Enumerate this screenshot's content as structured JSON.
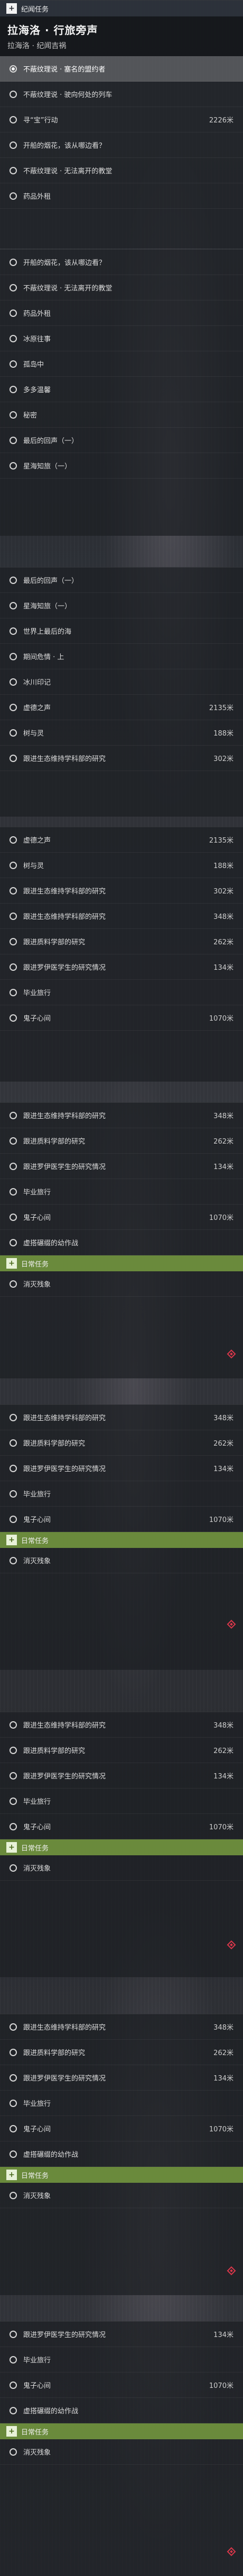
{
  "top": {
    "panel_label": "纪闻任务",
    "quest_title": "拉海洛 · 行旅旁声",
    "quest_subtitle": "拉海洛 · 纪闻吉祸"
  },
  "list1": [
    {
      "label": "不蔽纹理说 · 塞名的盟约者",
      "dist": "",
      "active": true
    },
    {
      "label": "不蔽纹理说 · 驶向何处的列车",
      "dist": ""
    },
    {
      "label": "寻“宝”行动",
      "dist": "2226米"
    },
    {
      "label": "开船的烟花，该从哪边看？",
      "dist": ""
    },
    {
      "label": "不蔽纹理说 · 无法离开的教堂",
      "dist": ""
    },
    {
      "label": "药品外租",
      "dist": ""
    }
  ],
  "list2": [
    {
      "label": "开船的烟花，该从哪边看？",
      "dist": ""
    },
    {
      "label": "不蔽纹理说 · 无法离开的教堂",
      "dist": ""
    },
    {
      "label": "药品外租",
      "dist": ""
    },
    {
      "label": "冰原往事",
      "dist": ""
    },
    {
      "label": "孤岛中",
      "dist": ""
    },
    {
      "label": "多多温馨",
      "dist": ""
    },
    {
      "label": "秘密",
      "dist": ""
    },
    {
      "label": "最后的回声（一）",
      "dist": ""
    },
    {
      "label": "星海知旅（一）",
      "dist": ""
    }
  ],
  "list3": [
    {
      "label": "最后的回声（一）",
      "dist": ""
    },
    {
      "label": "星海知旅（一）",
      "dist": ""
    },
    {
      "label": "世界上最后的海",
      "dist": ""
    },
    {
      "label": "期间危情 · 上",
      "dist": ""
    },
    {
      "label": "冰川印记",
      "dist": ""
    },
    {
      "label": "虚德之声",
      "dist": "2135米"
    },
    {
      "label": "树与灵",
      "dist": "188米"
    },
    {
      "label": "跟进生态维持学科部的研究",
      "dist": "302米"
    }
  ],
  "list4": [
    {
      "label": "虚德之声",
      "dist": "2135米"
    },
    {
      "label": "树与灵",
      "dist": "188米"
    },
    {
      "label": "跟进生态维持学科部的研究",
      "dist": "302米"
    },
    {
      "label": "跟进生态维持学科部的研究",
      "dist": "348米"
    },
    {
      "label": "跟进质料学部的研究",
      "dist": "262米"
    },
    {
      "label": "跟进罗伊医学生的研究情况",
      "dist": "134米"
    },
    {
      "label": "毕业旅行",
      "dist": ""
    },
    {
      "label": "鬼子心间",
      "dist": "1070米"
    }
  ],
  "list5": [
    {
      "label": "跟进生态维持学科部的研究",
      "dist": "348米"
    },
    {
      "label": "跟进质料学部的研究",
      "dist": "262米"
    },
    {
      "label": "跟进罗伊医学生的研究情况",
      "dist": "134米"
    },
    {
      "label": "毕业旅行",
      "dist": ""
    },
    {
      "label": "鬼子心间",
      "dist": "1070米"
    },
    {
      "label": "虚搭碾缀的幼作战",
      "dist": ""
    }
  ],
  "daily_label": "日常任务",
  "daily_item": "消灭残象",
  "list6": [
    {
      "label": "跟进生态维持学科部的研究",
      "dist": "348米"
    },
    {
      "label": "跟进质料学部的研究",
      "dist": "262米"
    },
    {
      "label": "跟进罗伊医学生的研究情况",
      "dist": "134米"
    },
    {
      "label": "毕业旅行",
      "dist": ""
    },
    {
      "label": "鬼子心间",
      "dist": "1070米"
    }
  ],
  "list7": [
    {
      "label": "跟进生态维持学科部的研究",
      "dist": "348米"
    },
    {
      "label": "跟进质料学部的研究",
      "dist": "262米"
    },
    {
      "label": "跟进罗伊医学生的研究情况",
      "dist": "134米"
    },
    {
      "label": "毕业旅行",
      "dist": ""
    },
    {
      "label": "鬼子心间",
      "dist": "1070米"
    }
  ],
  "list8": [
    {
      "label": "跟进生态维持学科部的研究",
      "dist": "348米"
    },
    {
      "label": "跟进质料学部的研究",
      "dist": "262米"
    },
    {
      "label": "跟进罗伊医学生的研究情况",
      "dist": "134米"
    },
    {
      "label": "毕业旅行",
      "dist": ""
    },
    {
      "label": "鬼子心间",
      "dist": "1070米"
    },
    {
      "label": "虚搭碾缀的幼作战",
      "dist": ""
    }
  ],
  "list9": [
    {
      "label": "跟进罗伊医学生的研究情况",
      "dist": "134米"
    },
    {
      "label": "毕业旅行",
      "dist": ""
    },
    {
      "label": "鬼子心间",
      "dist": "1070米"
    },
    {
      "label": "虚搭碾缀的幼作战",
      "dist": ""
    }
  ],
  "colors": {
    "accent_green": "#6a8a3c",
    "marker_red": "#d9364a",
    "active_row": "#ffffff"
  }
}
